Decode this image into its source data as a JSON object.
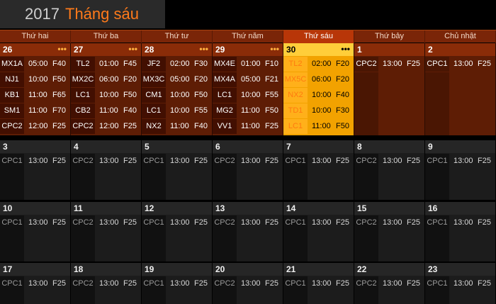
{
  "title": {
    "year": "2017",
    "month": "Tháng sáu"
  },
  "weekdays": [
    {
      "label": "Thứ hai",
      "active": false
    },
    {
      "label": "Thứ ba",
      "active": false
    },
    {
      "label": "Thứ tư",
      "active": false
    },
    {
      "label": "Thứ năm",
      "active": false
    },
    {
      "label": "Thứ sáu",
      "active": true
    },
    {
      "label": "Thứ bảy",
      "active": false
    },
    {
      "label": "Chủ nhật",
      "active": false
    }
  ],
  "more_label": "•••",
  "weeks": [
    [
      {
        "day": "26",
        "more": true,
        "events": [
          {
            "code": "MX1A",
            "time": "05:00",
            "flight": "F40"
          },
          {
            "code": "NJ1",
            "time": "10:00",
            "flight": "F50"
          },
          {
            "code": "KB1",
            "time": "11:00",
            "flight": "F65"
          },
          {
            "code": "SM1",
            "time": "11:00",
            "flight": "F70"
          },
          {
            "code": "CPC2",
            "time": "12:00",
            "flight": "F25"
          }
        ]
      },
      {
        "day": "27",
        "more": true,
        "events": [
          {
            "code": "TL2",
            "time": "01:00",
            "flight": "F45"
          },
          {
            "code": "MX2C",
            "time": "06:00",
            "flight": "F20"
          },
          {
            "code": "LC1",
            "time": "10:00",
            "flight": "F50"
          },
          {
            "code": "CB2",
            "time": "11:00",
            "flight": "F40"
          },
          {
            "code": "CPC2",
            "time": "12:00",
            "flight": "F25"
          }
        ]
      },
      {
        "day": "28",
        "more": true,
        "events": [
          {
            "code": "JF2",
            "time": "02:00",
            "flight": "F30"
          },
          {
            "code": "MX3C",
            "time": "05:00",
            "flight": "F20"
          },
          {
            "code": "CM1",
            "time": "10:00",
            "flight": "F50"
          },
          {
            "code": "LC1",
            "time": "10:00",
            "flight": "F55"
          },
          {
            "code": "NX2",
            "time": "11:00",
            "flight": "F40"
          }
        ]
      },
      {
        "day": "29",
        "more": true,
        "events": [
          {
            "code": "MX4E",
            "time": "01:00",
            "flight": "F10"
          },
          {
            "code": "MX4A",
            "time": "05:00",
            "flight": "F21"
          },
          {
            "code": "LC1",
            "time": "10:00",
            "flight": "F55"
          },
          {
            "code": "MG2",
            "time": "11:00",
            "flight": "F50"
          },
          {
            "code": "VV1",
            "time": "11:00",
            "flight": "F25"
          }
        ]
      },
      {
        "day": "30",
        "more": true,
        "today": true,
        "events": [
          {
            "code": "TL2",
            "time": "02:00",
            "flight": "F20"
          },
          {
            "code": "MX5C",
            "time": "06:00",
            "flight": "F20"
          },
          {
            "code": "NX2",
            "time": "10:00",
            "flight": "F40"
          },
          {
            "code": "TD1",
            "time": "10:00",
            "flight": "F30"
          },
          {
            "code": "LC1",
            "time": "11:00",
            "flight": "F50"
          }
        ]
      },
      {
        "day": "1",
        "more": false,
        "events": [
          {
            "code": "CPC2",
            "time": "13:00",
            "flight": "F25"
          }
        ]
      },
      {
        "day": "2",
        "more": false,
        "events": [
          {
            "code": "CPC1",
            "time": "13:00",
            "flight": "F25"
          }
        ]
      }
    ],
    [
      {
        "day": "3",
        "events": [
          {
            "code": "CPC1",
            "time": "13:00",
            "flight": "F25"
          }
        ]
      },
      {
        "day": "4",
        "events": [
          {
            "code": "CPC2",
            "time": "13:00",
            "flight": "F25"
          }
        ]
      },
      {
        "day": "5",
        "events": [
          {
            "code": "CPC1",
            "time": "13:00",
            "flight": "F25"
          }
        ]
      },
      {
        "day": "6",
        "events": [
          {
            "code": "CPC2",
            "time": "13:00",
            "flight": "F25"
          }
        ]
      },
      {
        "day": "7",
        "events": [
          {
            "code": "CPC1",
            "time": "13:00",
            "flight": "F25"
          }
        ]
      },
      {
        "day": "8",
        "events": [
          {
            "code": "CPC2",
            "time": "13:00",
            "flight": "F25"
          }
        ]
      },
      {
        "day": "9",
        "events": [
          {
            "code": "CPC1",
            "time": "13:00",
            "flight": "F25"
          }
        ]
      }
    ],
    [
      {
        "day": "10",
        "events": [
          {
            "code": "CPC1",
            "time": "13:00",
            "flight": "F25"
          }
        ]
      },
      {
        "day": "11",
        "events": [
          {
            "code": "CPC2",
            "time": "13:00",
            "flight": "F25"
          }
        ]
      },
      {
        "day": "12",
        "events": [
          {
            "code": "CPC1",
            "time": "13:00",
            "flight": "F25"
          }
        ]
      },
      {
        "day": "13",
        "events": [
          {
            "code": "CPC2",
            "time": "13:00",
            "flight": "F25"
          }
        ]
      },
      {
        "day": "14",
        "events": [
          {
            "code": "CPC1",
            "time": "13:00",
            "flight": "F25"
          }
        ]
      },
      {
        "day": "15",
        "events": [
          {
            "code": "CPC2",
            "time": "13:00",
            "flight": "F25"
          }
        ]
      },
      {
        "day": "16",
        "events": [
          {
            "code": "CPC1",
            "time": "13:00",
            "flight": "F25"
          }
        ]
      }
    ],
    [
      {
        "day": "17",
        "events": [
          {
            "code": "CPC1",
            "time": "13:00",
            "flight": "F25"
          }
        ]
      },
      {
        "day": "18",
        "events": [
          {
            "code": "CPC2",
            "time": "13:00",
            "flight": "F25"
          }
        ]
      },
      {
        "day": "19",
        "events": [
          {
            "code": "CPC1",
            "time": "13:00",
            "flight": "F25"
          }
        ]
      },
      {
        "day": "20",
        "events": [
          {
            "code": "CPC2",
            "time": "13:00",
            "flight": "F25"
          }
        ]
      },
      {
        "day": "21",
        "events": [
          {
            "code": "CPC1",
            "time": "13:00",
            "flight": "F25"
          }
        ]
      },
      {
        "day": "22",
        "events": [
          {
            "code": "CPC2",
            "time": "13:00",
            "flight": "F25"
          }
        ]
      },
      {
        "day": "23",
        "events": [
          {
            "code": "CPC1",
            "time": "13:00",
            "flight": "F25"
          }
        ]
      }
    ]
  ]
}
